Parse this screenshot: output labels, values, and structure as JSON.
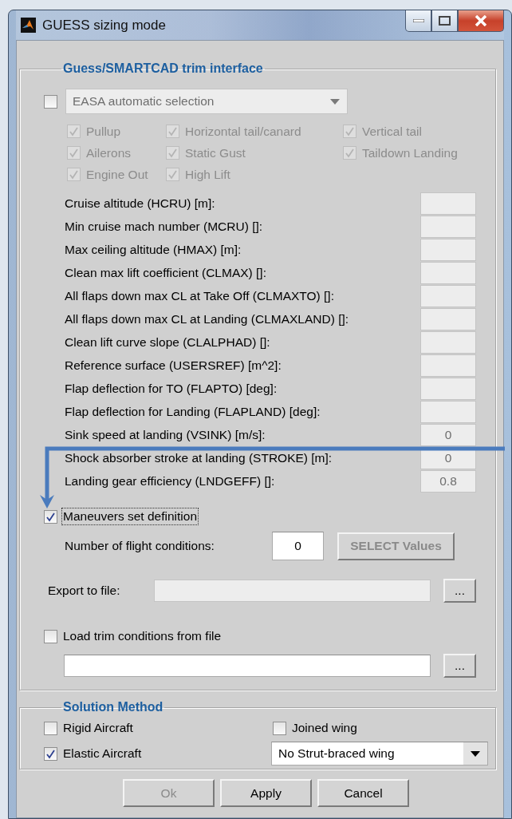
{
  "window": {
    "title": "GUESS sizing mode"
  },
  "trim_interface": {
    "title": "Guess/SMARTCAD trim interface",
    "easa": {
      "checked": false,
      "disabled": true,
      "value": "EASA automatic selection"
    },
    "maneuver_options": [
      {
        "label": "Pullup",
        "checked": true,
        "disabled": true
      },
      {
        "label": "Horizontal tail/canard",
        "checked": true,
        "disabled": true
      },
      {
        "label": "Vertical tail",
        "checked": true,
        "disabled": true
      },
      {
        "label": "Ailerons",
        "checked": true,
        "disabled": true
      },
      {
        "label": "Static Gust",
        "checked": true,
        "disabled": true
      },
      {
        "label": "Taildown Landing",
        "checked": true,
        "disabled": true
      },
      {
        "label": "Engine Out",
        "checked": true,
        "disabled": true
      },
      {
        "label": "High Lift",
        "checked": true,
        "disabled": true
      }
    ],
    "parameters": [
      {
        "label": "Cruise altitude (HCRU) [m]:",
        "disabled": true
      },
      {
        "label": "Min cruise mach number (MCRU) []:",
        "disabled": true
      },
      {
        "label": "Max ceiling altitude (HMAX) [m]:",
        "disabled": true
      },
      {
        "label": "Clean max lift coefficient (CLMAX) []:",
        "disabled": true
      },
      {
        "label": "All flaps down max CL at Take Off (CLMAXTO) []:",
        "disabled": true
      },
      {
        "label": "All flaps down max CL at Landing (CLMAXLAND) []:",
        "disabled": true
      },
      {
        "label": "Clean lift curve slope (CLALPHAD) []:",
        "disabled": true
      },
      {
        "label": "Reference surface (USERSREF) [m^2]:",
        "disabled": true
      },
      {
        "label": "Flap deflection for TO (FLAPTO) [deg]:",
        "disabled": true
      },
      {
        "label": "Flap deflection for Landing (FLAPLAND) [deg]:",
        "disabled": true
      },
      {
        "label": "Sink speed at landing (VSINK) [m/s]:",
        "value": "0",
        "disabled": true
      },
      {
        "label": "Shock absorber stroke at landing (STROKE) [m]:",
        "value": "0",
        "disabled": true
      },
      {
        "label": "Landing gear efficiency (LNDGEFF) []:",
        "value": "0.8",
        "disabled": true
      }
    ],
    "maneuvers": {
      "label": "Maneuvers set definition",
      "checked": true
    },
    "flight_conditions": {
      "label": "Number of flight conditions:",
      "value": "0"
    },
    "select_button": {
      "label": "SELECT Values",
      "disabled": true
    },
    "export": {
      "label": "Export to file:",
      "browse": "..."
    },
    "load": {
      "label": "Load trim conditions from file",
      "checked": false,
      "browse": "..."
    }
  },
  "solution_method": {
    "title": "Solution Method",
    "options": [
      {
        "label": "Rigid Aircraft",
        "checked": false
      },
      {
        "label": "Elastic Aircraft",
        "checked": true
      }
    ],
    "joined_wing": {
      "label": "Joined wing",
      "checked": false
    },
    "strut": {
      "value": "No Strut-braced wing"
    }
  },
  "buttons": [
    {
      "label": "Ok",
      "disabled": true
    },
    {
      "label": "Apply",
      "disabled": false
    },
    {
      "label": "Cancel",
      "disabled": false
    }
  ]
}
